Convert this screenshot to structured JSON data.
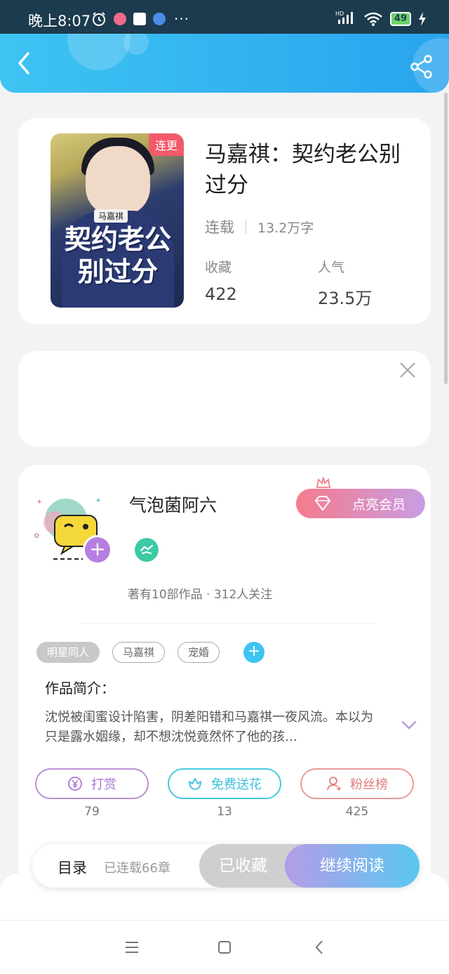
{
  "status_bar": {
    "time": "晚上8:07",
    "more": "···",
    "network": "HD",
    "battery": "49"
  },
  "header": {
    "back_icon": "back-arrow-icon",
    "share_icon": "share-icon"
  },
  "book": {
    "update_badge": "连更",
    "cover_small_title": "马嘉祺",
    "cover_big_title": "契约老公别过分",
    "title": "马嘉祺：契约老公别过分",
    "status": "连载",
    "word_count": "13.2万字",
    "collect_label": "收藏",
    "collect_value": "422",
    "popularity_label": "人气",
    "popularity_value": "23.5万"
  },
  "author": {
    "name": "气泡菌阿六",
    "vip_button": "点亮会员",
    "stats": "著有10部作品 · 312人关注",
    "follow_symbol": "+"
  },
  "tags": [
    "明星同人",
    "马嘉祺",
    "宠婚"
  ],
  "tag_add_symbol": "+",
  "intro": {
    "label": "作品简介：",
    "text": "沈悦被闺蜜设计陷害，阴差阳错和马嘉祺一夜风流。本以为只是露水姻缘，却不想沈悦竟然怀了他的孩…"
  },
  "actions": {
    "reward_label": "打赏",
    "reward_count": "79",
    "flower_label": "免费送花",
    "flower_count": "13",
    "fans_label": "粉丝榜",
    "fans_count": "425"
  },
  "bottom_bar": {
    "toc_label": "目录",
    "toc_count": "已连载66章",
    "collected_label": "已收藏",
    "read_label": "继续阅读"
  },
  "colors": {
    "header_start": "#3ec4f2",
    "header_end": "#29a4ee",
    "update_badge": "#f25a6a",
    "read_gradient_start": "#b49ce8",
    "read_gradient_end": "#59c8f0"
  }
}
